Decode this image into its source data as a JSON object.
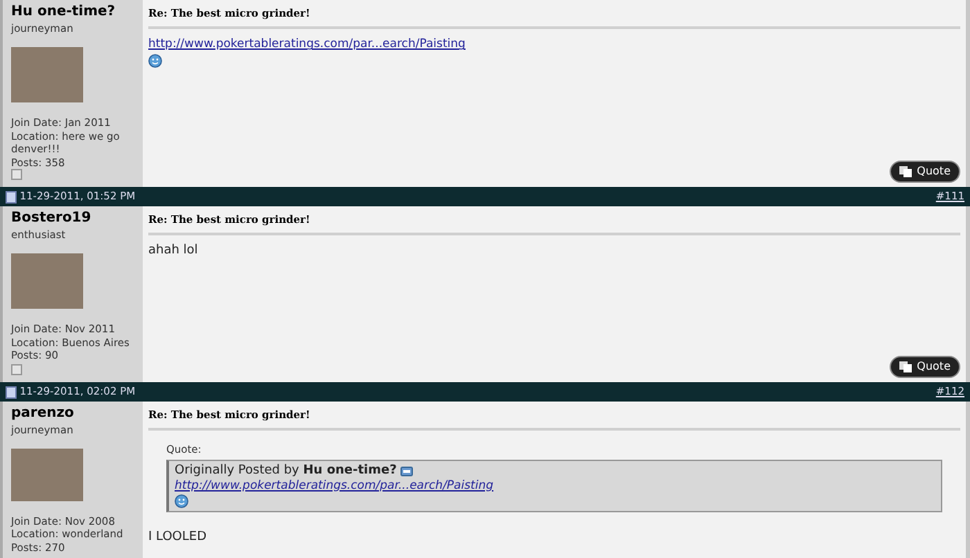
{
  "posts": [
    {
      "user": {
        "name": "Hu one-time?",
        "rank": "journeyman",
        "join": "Join Date: Jan 2011",
        "location": "Location: here we go denver!!!",
        "posts": "Posts: 358",
        "online": false
      },
      "title": "Re: The best micro grinder!",
      "body": [
        {
          "kind": "link",
          "text": "http://www.pokertableratings.com/par...earch/Paisting"
        },
        {
          "kind": "smiley"
        }
      ],
      "quote_button": "Quote"
    },
    {
      "header": {
        "date": "11-29-2011, 01:52 PM",
        "number": "#111"
      },
      "user": {
        "name": "Bostero19",
        "rank": "enthusiast",
        "join": "Join Date: Nov 2011",
        "location": "Location: Buenos Aires",
        "posts": "Posts: 90",
        "online": false
      },
      "title": "Re: The best micro grinder!",
      "body": [
        {
          "kind": "text",
          "text": "ahah lol"
        }
      ],
      "quote_button": "Quote"
    },
    {
      "header": {
        "date": "11-29-2011, 02:02 PM",
        "number": "#112"
      },
      "user": {
        "name": "parenzo",
        "rank": "journeyman",
        "join": "Join Date: Nov 2008",
        "location": "Location: wonderland",
        "posts": "Posts: 270"
      },
      "title": "Re: The best micro grinder!",
      "body": [
        {
          "kind": "quote",
          "label": "Quote:",
          "by": "Originally Posted by **Hu one-time?**",
          "link": "http://www.pokertableratings.com/par...earch/Paisting",
          "smiley": true
        },
        {
          "kind": "text",
          "text": "I LOOLED"
        }
      ]
    }
  ]
}
